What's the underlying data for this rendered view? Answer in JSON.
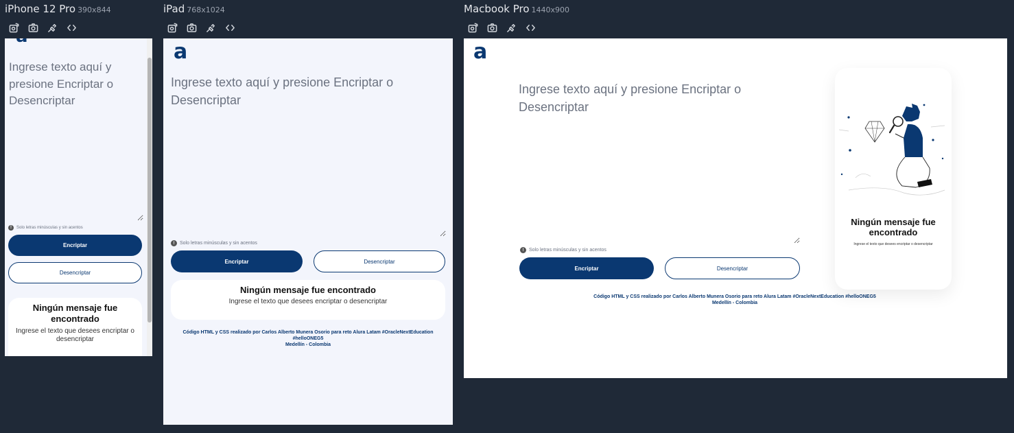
{
  "devices": [
    {
      "name": "iPhone 12 Pro",
      "size": "390x844"
    },
    {
      "name": "iPad",
      "size": "768x1024"
    },
    {
      "name": "Macbook Pro",
      "size": "1440x900"
    }
  ],
  "toolbar": {
    "icons": [
      "rotate-screenshot-icon",
      "camera-icon",
      "inspect-icon",
      "code-icon"
    ]
  },
  "app": {
    "logo": "a",
    "placeholder": "Ingrese texto aquí y presione Encriptar o Desencriptar",
    "hint": "Solo letras minúsculas y sin acentos",
    "hint_icon": "!",
    "encrypt_label": "Encriptar",
    "decrypt_label": "Desencriptar",
    "empty_title": "Ningún mensaje fue encontrado",
    "empty_text": "Ingrese el texto que desees encriptar o desencriptar",
    "footer_line1": "Código HTML y CSS realizado por Carlos Alberto Munera Osorio para reto Alura Latam #OracleNextEducation #helloONEG5",
    "footer_line2": "Medellín - Colombia"
  },
  "colors": {
    "primary": "#0a3871",
    "page_bg": "#f3f5fc",
    "host_bg": "#1f2937"
  }
}
